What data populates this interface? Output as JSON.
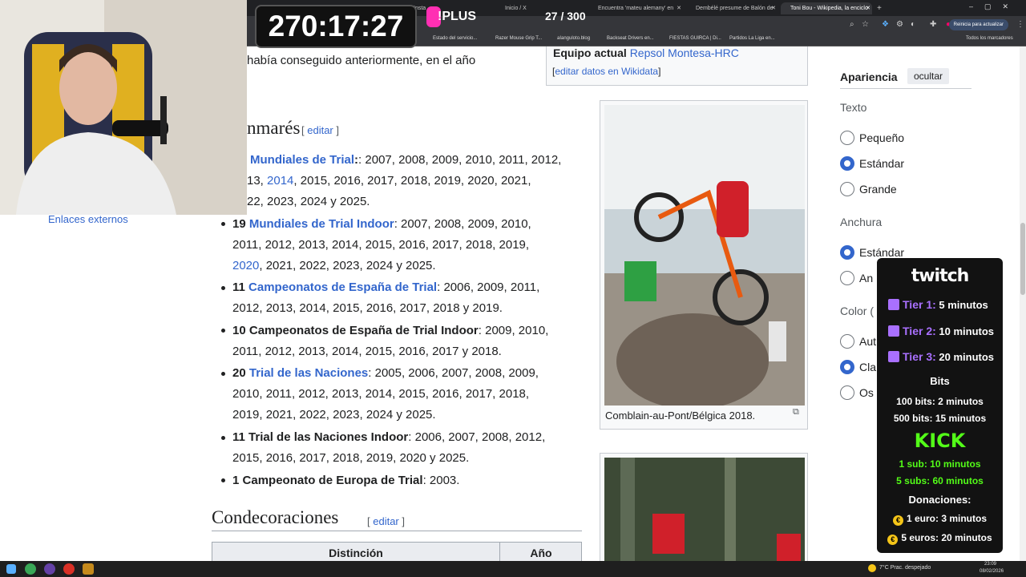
{
  "browser": {
    "tabs": [
      {
        "label": "Inicio / X"
      },
      {
        "label": "Encuentra 'mateu alemany' en"
      },
      {
        "label": "Dembélé presume de Balón de"
      },
      {
        "label": "Toni Bou - Wikipedia, la enciclo",
        "active": true
      }
    ],
    "partial_tab": "Insta",
    "update_button": "Reinicia para actualizar",
    "bookmarks": [
      "Estado del servicio...",
      "Razer Mouse Grip T...",
      "aIanguloto.blog",
      "Backseat Drivers en...",
      "FIESTAS GUIRCA | Di...",
      "Partidos La Liga en..."
    ],
    "all_bookmarks": "Todos los marcadores"
  },
  "overlay": {
    "timer": "270:17:27",
    "plus_label": "!PLUS",
    "counter": "27 / 300"
  },
  "article": {
    "intro_line": "había conseguido anteriormente, en el año",
    "infobox": {
      "team_label": "Equipo actual",
      "team_value": "Repsol Montesa-HRC",
      "edit_wikidata": "editar datos en Wikidata"
    },
    "sidebar_link": "Enlaces externos",
    "palmares_heading": "nmarés",
    "edit_label": "editar",
    "palmares": [
      {
        "lines": [
          [
            "",
            [
              "Mundiales de Trial"
            ],
            ": 2007, 2008, 2009, 2010, 2011, 2012,"
          ],
          [
            "13, ",
            [
              "2014"
            ],
            ", 2015, 2016, 2017, 2018, 2019, 2020, 2021,"
          ],
          [
            "22, 2023, 2024 y 2025."
          ]
        ]
      },
      {
        "count": "19",
        "link": "Mundiales de Trial Indoor",
        "l1": ": 2007, 2008, 2009, 2010,",
        "l2": "2011, 2012, 2013, 2014, 2015, 2016, 2017, 2018, 2019,",
        "l3_link": "2020",
        "l3": ", 2021, 2022, 2023, 2024 y 2025."
      },
      {
        "count": "11",
        "link": "Campeonatos de España de Trial",
        "l1": ": 2006, 2009, 2011,",
        "l2": "2012, 2013, 2014, 2015, 2016, 2017, 2018 y 2019."
      },
      {
        "count": "10",
        "name": "Campeonatos de España de Trial Indoor",
        "l1": ": 2009, 2010,",
        "l2": "2011, 2012, 2013, 2014, 2015, 2016, 2017 y 2018."
      },
      {
        "count": "20",
        "link": "Trial de las Naciones",
        "l1": ": 2005, 2006, 2007, 2008, 2009,",
        "l2": "2010, 2011, 2012, 2013, 2014, 2015, 2016, 2017, 2018,",
        "l3": "2019, 2021, 2022, 2023, 2024 y 2025."
      },
      {
        "count": "11",
        "name": "Trial de las Naciones Indoor",
        "l1": ": 2006, 2007, 2008, 2012,",
        "l2": "2015, 2016, 2017, 2018, 2019, 2020 y 2025."
      },
      {
        "count": "1",
        "name": "Campeonato de Europa de Trial",
        "l1": ": 2003."
      }
    ],
    "condecoraciones_heading": "Condecoraciones",
    "table_headers": [
      "Distinción",
      "Año"
    ],
    "image_caption": "Comblain-au-Pont/Bélgica 2018."
  },
  "appearance": {
    "title": "Apariencia",
    "hide": "ocultar",
    "text_label": "Texto",
    "text_options": [
      "Pequeño",
      "Estándar",
      "Grande"
    ],
    "width_label": "Anchura",
    "width_options": [
      "Estándar",
      "An"
    ],
    "color_label": "Color (",
    "color_options": [
      "Aut",
      "Cla",
      "Os"
    ]
  },
  "stream_panel": {
    "brand_top": "twitch",
    "tiers": [
      {
        "name": "Tier 1:",
        "value": "5 minutos"
      },
      {
        "name": "Tier 2:",
        "value": "10 minutos"
      },
      {
        "name": "Tier 3:",
        "value": "20 minutos"
      }
    ],
    "bits_title": "Bits",
    "bits": [
      "100 bits: 2 minutos",
      "500 bits: 15 minutos"
    ],
    "brand_mid": "KICK",
    "kick": [
      "1 sub: 10 minutos",
      "5 subs: 60 minutos"
    ],
    "donations_title": "Donaciones:",
    "donations": [
      "1 euro: 3 minutos",
      "5 euros: 20 minutos"
    ],
    "euro_symbol": "€"
  },
  "taskbar": {
    "weather": "7°C  Prac. despejado",
    "time": "23:09",
    "date": "08/02/2026"
  },
  "colors": {
    "link": "#3366cc",
    "twitch": "#a970ff",
    "kick": "#53fc18"
  }
}
